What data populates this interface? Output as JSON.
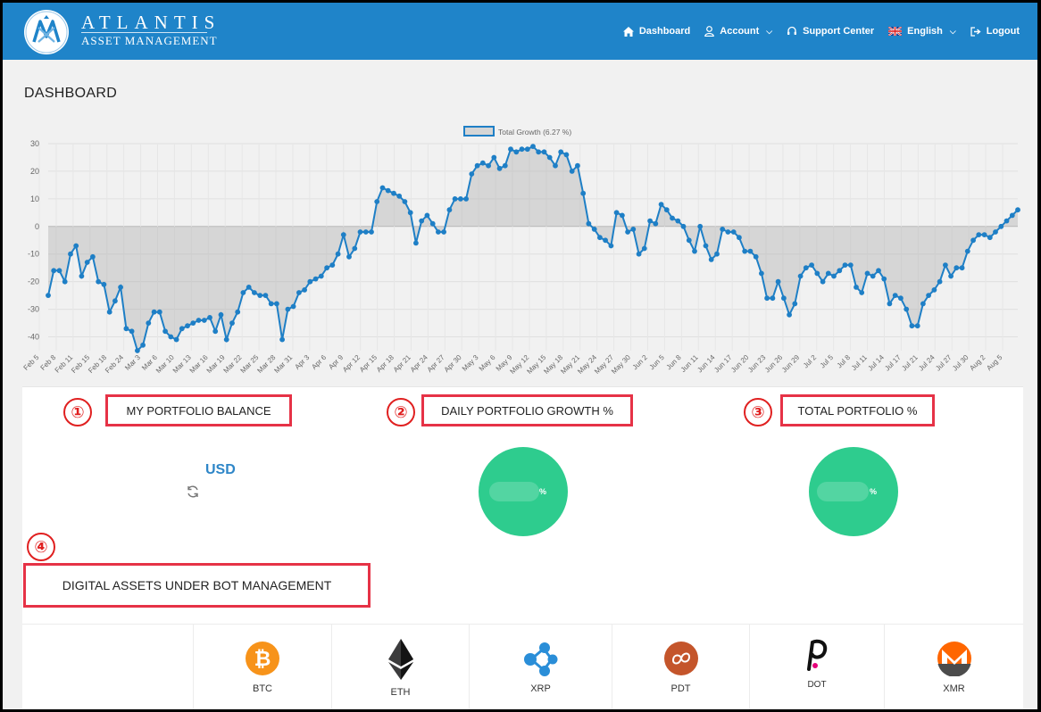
{
  "header": {
    "brand_name": "ATLANTIS",
    "brand_sub": "ASSET MANAGEMENT",
    "nav": [
      {
        "label": "Dashboard",
        "icon": "home-icon"
      },
      {
        "label": "Account",
        "icon": "user-icon",
        "dropdown": true
      },
      {
        "label": "Support Center",
        "icon": "headset-icon"
      },
      {
        "label": "English",
        "icon": "uk-flag-icon",
        "dropdown": true
      },
      {
        "label": "Logout",
        "icon": "logout-icon"
      }
    ],
    "colors": {
      "bar": "#1f84c9"
    }
  },
  "page": {
    "title": "DASHBOARD"
  },
  "chart_data": {
    "type": "area",
    "legend": "Total Growth (6.27 %)",
    "legend_placement": "top-center",
    "ylim": [
      -45,
      30
    ],
    "yticks": [
      30,
      20,
      10,
      0,
      -10,
      -20,
      -30,
      -40
    ],
    "grid": true,
    "xticks": [
      "Feb 5",
      "Feb 8",
      "Feb 11",
      "Feb 15",
      "Feb 18",
      "Feb 24",
      "Mar 3",
      "Mar 6",
      "Mar 10",
      "Mar 13",
      "Mar 16",
      "Mar 19",
      "Mar 22",
      "Mar 25",
      "Mar 28",
      "Mar 31",
      "Apr 3",
      "Apr 6",
      "Apr 9",
      "Apr 12",
      "Apr 15",
      "Apr 18",
      "Apr 21",
      "Apr 24",
      "Apr 27",
      "Apr 30",
      "May 3",
      "May 6",
      "May 9",
      "May 12",
      "May 15",
      "May 18",
      "May 21",
      "May 24",
      "May 27",
      "May 30",
      "Jun 2",
      "Jun 5",
      "Jun 8",
      "Jun 11",
      "Jun 14",
      "Jun 17",
      "Jun 20",
      "Jun 23",
      "Jun 26",
      "Jun 29",
      "Jul 2",
      "Jul 5",
      "Jul 8",
      "Jul 11",
      "Jul 14",
      "Jul 17",
      "Jul 21",
      "Jul 24",
      "Jul 27",
      "Jul 30",
      "Aug 2",
      "Aug 5"
    ],
    "values": [
      -25,
      -16,
      -16,
      -20,
      -10,
      -7,
      -18,
      -13,
      -11,
      -20,
      -21,
      -31,
      -27,
      -22,
      -37,
      -38,
      -45,
      -43,
      -35,
      -31,
      -31,
      -38,
      -40,
      -41,
      -37,
      -36,
      -35,
      -34,
      -34,
      -33,
      -38,
      -32,
      -41,
      -35,
      -31,
      -24,
      -22,
      -24,
      -25,
      -25,
      -28,
      -28,
      -41,
      -30,
      -29,
      -24,
      -23,
      -20,
      -19,
      -18,
      -15,
      -14,
      -10,
      -3,
      -11,
      -8,
      -2,
      -2,
      -2,
      9,
      14,
      13,
      12,
      11,
      9,
      5,
      -6,
      2,
      4,
      1,
      -2,
      -2,
      6,
      10,
      10,
      10,
      19,
      22,
      23,
      22,
      25,
      21,
      22,
      28,
      27,
      28,
      28,
      29,
      27,
      27,
      25,
      22,
      27,
      26,
      20,
      22,
      12,
      1,
      -1,
      -4,
      -5,
      -7,
      5,
      4,
      -2,
      -1,
      -10,
      -8,
      2,
      1,
      8,
      6,
      3,
      2,
      0,
      -5,
      -9,
      0,
      -7,
      -12,
      -10,
      -1,
      -2,
      -2,
      -4,
      -9,
      -9,
      -11,
      -17,
      -26,
      -26,
      -20,
      -26,
      -32,
      -28,
      -18,
      -15,
      -14,
      -17,
      -20,
      -17,
      -18,
      -16,
      -14,
      -14,
      -22,
      -24,
      -17,
      -18,
      -16,
      -19,
      -28,
      -25,
      -26,
      -30,
      -36,
      -36,
      -28,
      -25,
      -23,
      -20,
      -14,
      -18,
      -15,
      -15,
      -9,
      -5,
      -3,
      -3,
      -4,
      -2,
      0,
      2,
      4,
      6
    ]
  },
  "widgets": {
    "balance": {
      "num": "①",
      "title": "MY PORTFOLIO BALANCE",
      "currency": "USD"
    },
    "daily": {
      "num": "②",
      "title": "DAILY PORTFOLIO GROWTH %",
      "unit": "%"
    },
    "total": {
      "num": "③",
      "title": "TOTAL PORTFOLIO %",
      "unit": "%"
    },
    "assets": {
      "num": "④",
      "title": "DIGITAL ASSETS UNDER BOT MANAGEMENT"
    }
  },
  "assets": [
    {
      "symbol": "BTC",
      "icon": "bitcoin-icon",
      "color": "#f7931a"
    },
    {
      "symbol": "ETH",
      "icon": "ethereum-icon",
      "color": "#3c3c3d"
    },
    {
      "symbol": "XRP",
      "icon": "ripple-icon",
      "color": "#2a8ed8"
    },
    {
      "symbol": "PDT",
      "icon": "pdt-icon",
      "color": "#c4552b"
    },
    {
      "symbol": "DOT",
      "icon": "polkadot-icon",
      "color": "#e6007a"
    },
    {
      "symbol": "XMR",
      "icon": "monero-icon",
      "color": "#ff6600"
    }
  ],
  "colors": {
    "highlight": "#e63246",
    "accent_green": "#2ecc8e",
    "line": "#1e7fc6"
  }
}
